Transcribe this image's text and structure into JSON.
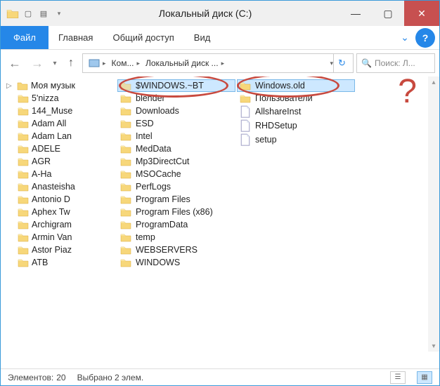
{
  "title": "Локальный диск (C:)",
  "ribbon": {
    "file": "Файл",
    "home": "Главная",
    "share": "Общий доступ",
    "view": "Вид"
  },
  "breadcrumb": {
    "seg1": "Ком...",
    "seg2": "Локальный диск ..."
  },
  "search_placeholder": "Поиск: Л...",
  "tree": {
    "root": "Моя музык",
    "items": [
      "5'nizza",
      "144_Muse",
      "Adam All",
      "Adam Lan",
      "ADELE",
      "AGR",
      "A-Ha",
      "Anasteisha",
      "Antonio D",
      "Aphex Tw",
      "Archigram",
      "Armin Van",
      "Astor Piaz",
      "ATB"
    ]
  },
  "col1": [
    "$WINDOWS.~BT",
    "blender",
    "Downloads",
    "ESD",
    "Intel",
    "MedData",
    "Mp3DirectCut",
    "MSOCache",
    "PerfLogs",
    "Program Files",
    "Program Files (x86)",
    "ProgramData",
    "temp",
    "WEBSERVERS",
    "WINDOWS"
  ],
  "col2_folders": [
    "Windows.old",
    "Пользователи"
  ],
  "col2_files": [
    "AllshareInst",
    "RHDSetup",
    "setup"
  ],
  "status": {
    "count_label": "Элементов:",
    "count": "20",
    "selected": "Выбрано 2 элем."
  },
  "annotation": "?"
}
